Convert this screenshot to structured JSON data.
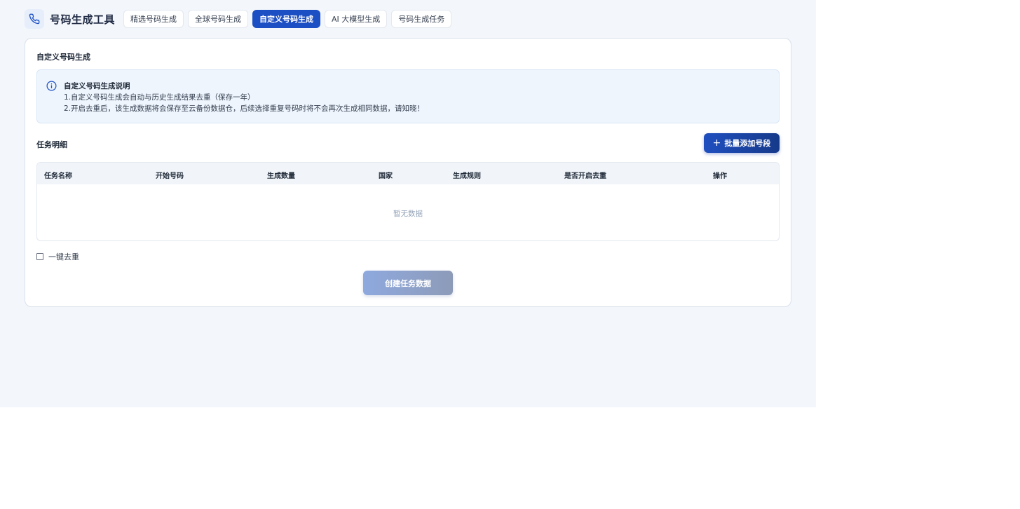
{
  "header": {
    "logo_icon": "phone-icon",
    "app_title": "号码生成工具",
    "tabs": [
      {
        "label": "精选号码生成",
        "active": false
      },
      {
        "label": "全球号码生成",
        "active": false
      },
      {
        "label": "自定义号码生成",
        "active": true
      },
      {
        "label": "AI 大模型生成",
        "active": false
      },
      {
        "label": "号码生成任务",
        "active": false
      }
    ]
  },
  "card": {
    "title": "自定义号码生成",
    "info": {
      "icon": "info-icon",
      "title": "自定义号码生成说明",
      "line1": "1.自定义号码生成会自动与历史生成结果去重（保存一年）",
      "line2": "2.开启去重后，该生成数据将会保存至云备份数据仓，后续选择重复号码时将不会再次生成相同数据，请知晓！"
    },
    "detail_title": "任务明细",
    "batch_button": {
      "icon": "plus-icon",
      "label": "批量添加号段"
    },
    "table": {
      "columns": [
        "任务名称",
        "开始号码",
        "生成数量",
        "国家",
        "生成规则",
        "是否开启去重",
        "操作"
      ],
      "rows": [],
      "empty_text": "暂无数据"
    },
    "dedupe": {
      "label": "一键去重",
      "checked": false
    },
    "create_button": {
      "label": "创建任务数据",
      "disabled": true
    }
  },
  "colors": {
    "accent": "#1d4fc4",
    "background": "#f3f6fa",
    "info_bg": "#eef5fd"
  }
}
